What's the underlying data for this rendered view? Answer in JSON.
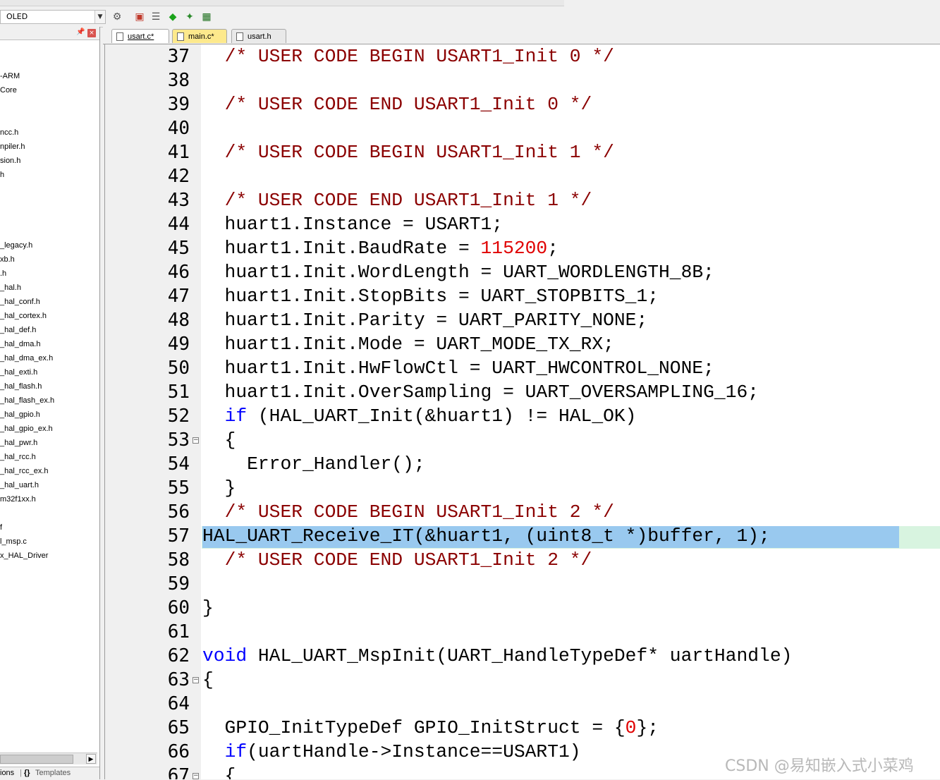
{
  "toolbar": {
    "target_name": "OLED",
    "icons": [
      "target-options-icon",
      "manage-components-icon",
      "file-extensions-icon",
      "pack-installer-icon",
      "select-packs-icon"
    ]
  },
  "project_panel": {
    "items": [
      "-ARM",
      "Core",
      "ncc.h",
      "npiler.h",
      "sion.h",
      "h",
      "_legacy.h",
      "xb.h",
      ".h",
      "_hal.h",
      "_hal_conf.h",
      "_hal_cortex.h",
      "_hal_def.h",
      "_hal_dma.h",
      "_hal_dma_ex.h",
      "_hal_exti.h",
      "_hal_flash.h",
      "_hal_flash_ex.h",
      "_hal_gpio.h",
      "_hal_gpio_ex.h",
      "_hal_pwr.h",
      "_hal_rcc.h",
      "_hal_rcc_ex.h",
      "_hal_uart.h",
      "m32f1xx.h",
      "f",
      "l_msp.c",
      "x_HAL_Driver"
    ],
    "bottom_tabs": [
      "ions",
      "{}",
      "Templates"
    ]
  },
  "tabs": [
    {
      "label": "usart.c*"
    },
    {
      "label": "main.c*"
    },
    {
      "label": "usart.h"
    }
  ],
  "editor": {
    "lines": [
      {
        "n": "37",
        "text": "  /* USER CODE BEGIN USART1_Init 0 */"
      },
      {
        "n": "38",
        "text": ""
      },
      {
        "n": "39",
        "text": "  /* USER CODE END USART1_Init 0 */"
      },
      {
        "n": "40",
        "text": ""
      },
      {
        "n": "41",
        "text": "  /* USER CODE BEGIN USART1_Init 1 */"
      },
      {
        "n": "42",
        "text": ""
      },
      {
        "n": "43",
        "text": "  /* USER CODE END USART1_Init 1 */"
      },
      {
        "n": "44",
        "text": "  huart1.Instance = USART1;"
      },
      {
        "n": "45",
        "text": "  huart1.Init.BaudRate = 115200;"
      },
      {
        "n": "46",
        "text": "  huart1.Init.WordLength = UART_WORDLENGTH_8B;"
      },
      {
        "n": "47",
        "text": "  huart1.Init.StopBits = UART_STOPBITS_1;"
      },
      {
        "n": "48",
        "text": "  huart1.Init.Parity = UART_PARITY_NONE;"
      },
      {
        "n": "49",
        "text": "  huart1.Init.Mode = UART_MODE_TX_RX;"
      },
      {
        "n": "50",
        "text": "  huart1.Init.HwFlowCtl = UART_HWCONTROL_NONE;"
      },
      {
        "n": "51",
        "text": "  huart1.Init.OverSampling = UART_OVERSAMPLING_16;"
      },
      {
        "n": "52",
        "text": "  if (HAL_UART_Init(&huart1) != HAL_OK)"
      },
      {
        "n": "53",
        "text": "  {"
      },
      {
        "n": "54",
        "text": "    Error_Handler();"
      },
      {
        "n": "55",
        "text": "  }"
      },
      {
        "n": "56",
        "text": "  /* USER CODE BEGIN USART1_Init 2 */"
      },
      {
        "n": "57",
        "text": "HAL_UART_Receive_IT(&huart1, (uint8_t *)buffer, 1);"
      },
      {
        "n": "58",
        "text": "  /* USER CODE END USART1_Init 2 */"
      },
      {
        "n": "59",
        "text": ""
      },
      {
        "n": "60",
        "text": "}"
      },
      {
        "n": "61",
        "text": ""
      },
      {
        "n": "62",
        "text": "void HAL_UART_MspInit(UART_HandleTypeDef* uartHandle)"
      },
      {
        "n": "63",
        "text": "{"
      },
      {
        "n": "64",
        "text": ""
      },
      {
        "n": "65",
        "text": "  GPIO_InitTypeDef GPIO_InitStruct = {0};"
      },
      {
        "n": "66",
        "text": "  if(uartHandle->Instance==USART1)"
      },
      {
        "n": "67",
        "text": "  {"
      }
    ],
    "comment_color": "#8b0000",
    "keyword_color": "#0000ff",
    "number_color": "#e00000",
    "selection_color": "#99c9ef",
    "current_line_color": "#d8f4e0"
  },
  "watermark": "CSDN @易知嵌入式小菜鸡"
}
